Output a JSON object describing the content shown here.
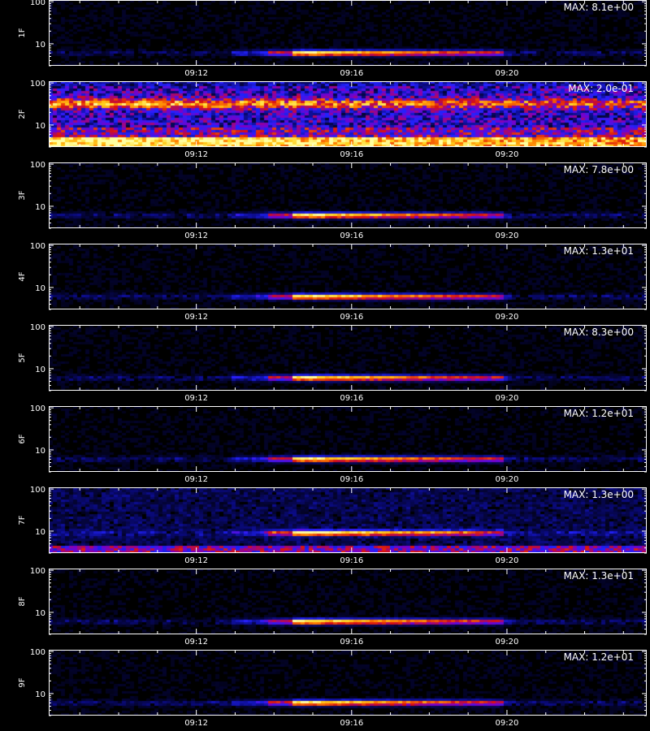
{
  "chart_data": {
    "type": "heatmap",
    "x_tick_labels": [
      "09:12",
      "09:16",
      "09:20"
    ],
    "x_tick_minutes": [
      12,
      16,
      20
    ],
    "x_range_minutes": [
      8.2,
      23.6
    ],
    "y_scale": "log",
    "y_tick_labels": [
      "10",
      "100"
    ],
    "y_tick_values": [
      10,
      100
    ],
    "y_range": [
      3,
      110
    ],
    "colormap": [
      "#000000",
      "#0a0a80",
      "#2222ff",
      "#7a00c8",
      "#d81010",
      "#ff7a00",
      "#ffd21e",
      "#ffffa0"
    ],
    "panels": [
      {
        "label": "1F",
        "max_label": "MAX: 8.1e+00",
        "max": 8.1,
        "event": {
          "start_min": 13.9,
          "end_min": 19.95,
          "level": 6
        }
      },
      {
        "label": "2F",
        "max_label": "MAX: 2.0e-01",
        "max": 0.2,
        "event": null
      },
      {
        "label": "3F",
        "max_label": "MAX: 7.8e+00",
        "max": 7.8,
        "event": {
          "start_min": 13.9,
          "end_min": 19.95,
          "level": 6
        }
      },
      {
        "label": "4F",
        "max_label": "MAX: 1.3e+01",
        "max": 13,
        "event": {
          "start_min": 13.9,
          "end_min": 19.95,
          "level": 6
        }
      },
      {
        "label": "5F",
        "max_label": "MAX: 8.3e+00",
        "max": 8.3,
        "event": {
          "start_min": 13.9,
          "end_min": 19.95,
          "level": 6
        }
      },
      {
        "label": "6F",
        "max_label": "MAX: 1.2e+01",
        "max": 12,
        "event": {
          "start_min": 13.9,
          "end_min": 19.95,
          "level": 6
        }
      },
      {
        "label": "7F",
        "max_label": "MAX: 1.3e+00",
        "max": 1.3,
        "event": {
          "start_min": 13.9,
          "end_min": 19.95,
          "level": 9
        }
      },
      {
        "label": "8F",
        "max_label": "MAX: 1.3e+01",
        "max": 13,
        "event": {
          "start_min": 13.9,
          "end_min": 19.95,
          "level": 6
        }
      },
      {
        "label": "9F",
        "max_label": "MAX: 1.2e+01",
        "max": 12,
        "event": {
          "start_min": 13.9,
          "end_min": 19.95,
          "level": 6
        }
      }
    ]
  }
}
